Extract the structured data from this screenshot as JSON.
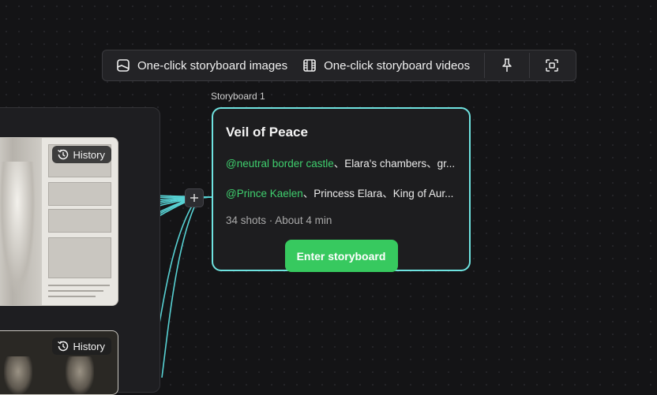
{
  "toolbar": {
    "images_label": "One-click storyboard images",
    "videos_label": "One-click storyboard videos",
    "images_icon": "image-frame-icon",
    "videos_icon": "film-icon",
    "pin_icon": "pin-icon",
    "fit_icon": "fit-screen-icon"
  },
  "image_cards": [
    {
      "badge": "History"
    },
    {
      "badge": "History"
    }
  ],
  "storyboard": {
    "label": "Storyboard 1",
    "title": "Veil of Peace",
    "locations_mention": "@neutral border castle",
    "locations_rest": "、Elara's chambers、gr...",
    "characters_mention": "@Prince Kaelen",
    "characters_rest": "、Princess Elara、King of Aur...",
    "meta": "34 shots · About 4 min",
    "enter_button": "Enter storyboard"
  },
  "colors": {
    "background": "#141416",
    "accent_green": "#37c95f",
    "mention_green": "#3fcf6e",
    "card_border_cyan": "#6fe3e0",
    "wire_cyan": "#5fe6e8"
  }
}
